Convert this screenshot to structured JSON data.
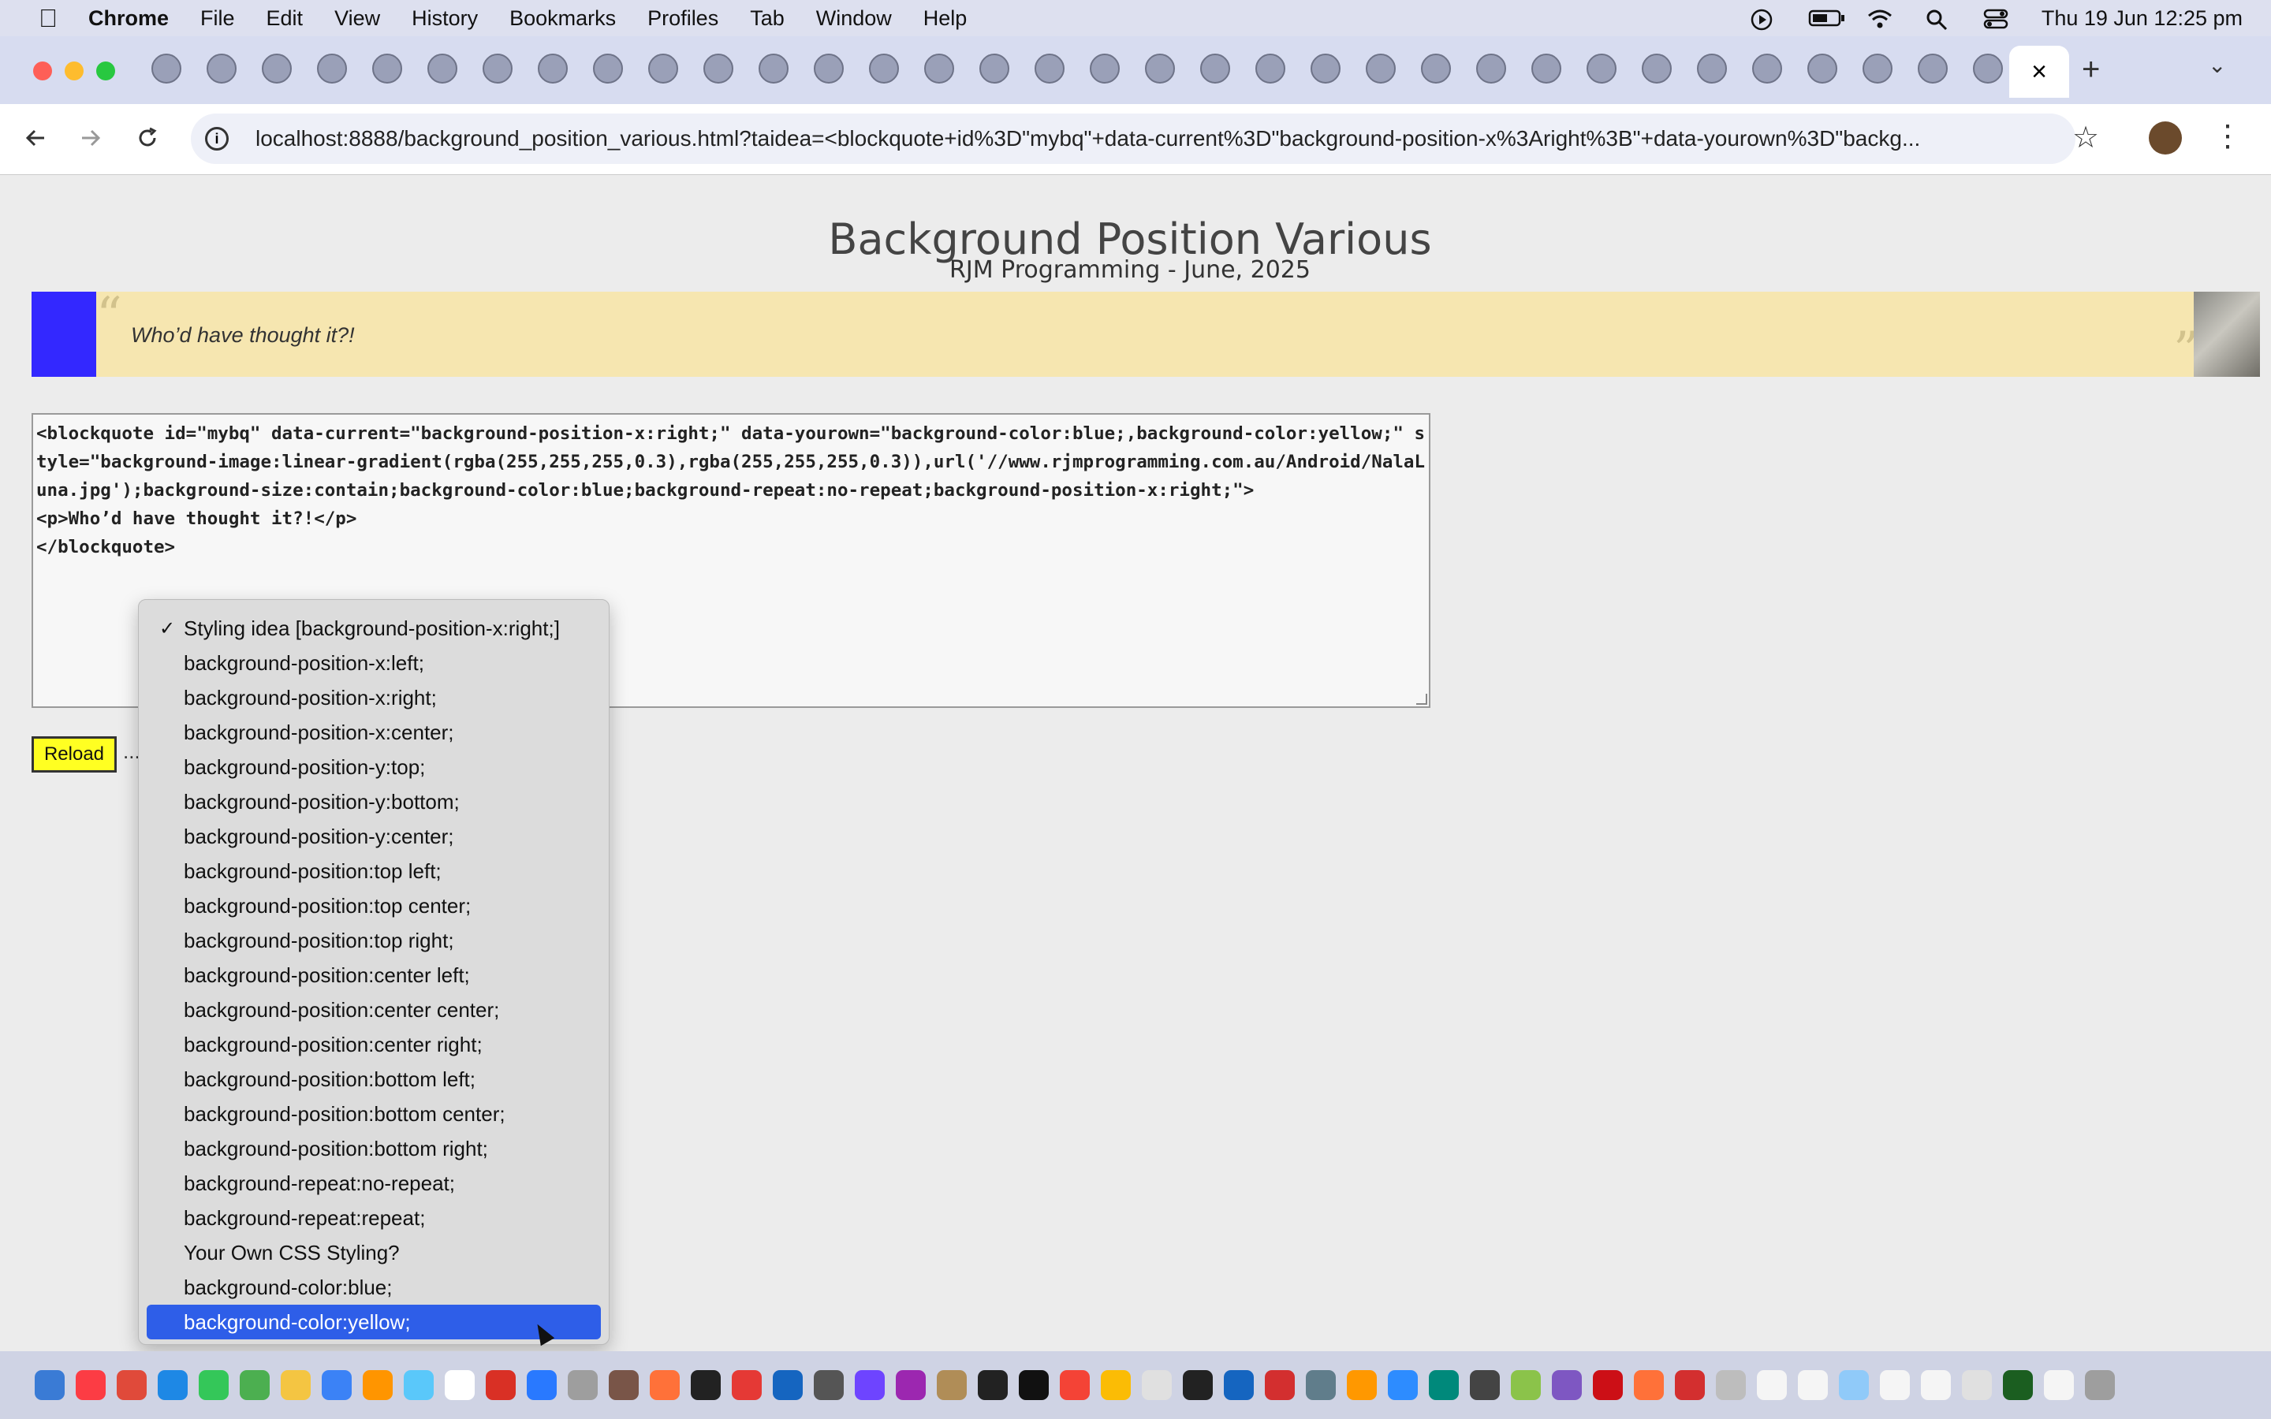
{
  "menubar": {
    "app": "Chrome",
    "items": [
      "File",
      "Edit",
      "View",
      "History",
      "Bookmarks",
      "Profiles",
      "Tab",
      "Window",
      "Help"
    ],
    "clock": "Thu 19 Jun  12:25 pm"
  },
  "browser": {
    "url": "localhost:8888/background_position_various.html?taidea=<blockquote+id%3D\"mybq\"+data-current%3D\"background-position-x%3Aright%3B\"+data-yourown%3D\"backg...",
    "active_tab_close": "×",
    "new_tab": "+",
    "tab_menu": "⌄"
  },
  "page": {
    "title": "Background Position Various",
    "subtitle": "RJM Programming - June, 2025",
    "blockquote_text": "Who’d have thought it?!",
    "quote_open": "“",
    "quote_close": "”",
    "textarea_value": "<blockquote id=\"mybq\" data-current=\"background-position-x:right;\" data-yourown=\"background-color:blue;,background-color:yellow;\" style=\"background-image:linear-gradient(rgba(255,255,255,0.3),rgba(255,255,255,0.3)),url('//www.rjmprogramming.com.au/Android/NalaLuna.jpg');background-size:contain;background-color:blue;background-repeat:no-repeat;background-position-x:right;\">\n<p>Who’d have thought it?!</p>\n</blockquote>",
    "reload_label": "Reload",
    "ellipsis": "..."
  },
  "dropdown": {
    "check_mark": "✓",
    "options": [
      "Styling idea [background-position-x:right;]",
      "background-position-x:left;",
      "background-position-x:right;",
      "background-position-x:center;",
      "background-position-y:top;",
      "background-position-y:bottom;",
      "background-position-y:center;",
      "background-position:top left;",
      "background-position:top center;",
      "background-position:top right;",
      "background-position:center left;",
      "background-position:center center;",
      "background-position:center right;",
      "background-position:bottom left;",
      "background-position:bottom center;",
      "background-position:bottom right;",
      "background-repeat:no-repeat;",
      "background-repeat:repeat;",
      "Your Own CSS Styling?",
      "background-color:blue;",
      "background-color:yellow;"
    ],
    "checked_index": 0,
    "highlighted_index": 20
  }
}
